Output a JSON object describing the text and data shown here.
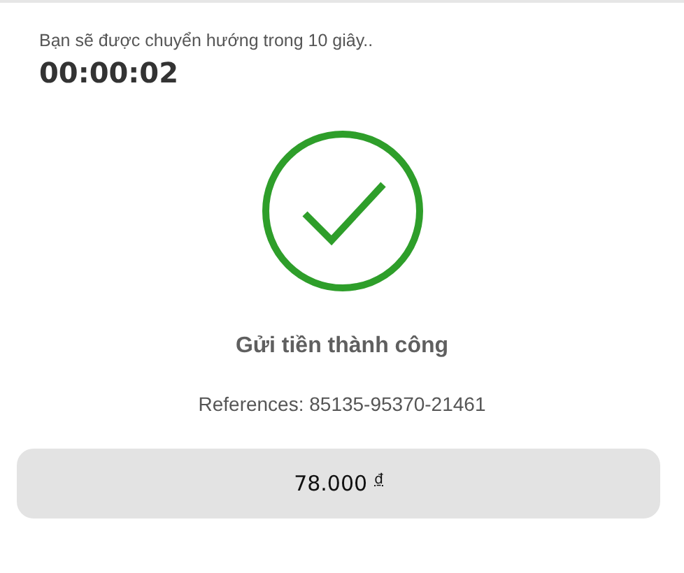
{
  "redirect_notice": "Bạn sẽ được chuyển hướng trong 10 giây..",
  "timer": "00:00:02",
  "status": {
    "kind": "success",
    "title": "Gửi tiền thành công"
  },
  "reference": "References: 85135-95370-21461",
  "amount": {
    "value": "78.000",
    "currency": "₫"
  }
}
